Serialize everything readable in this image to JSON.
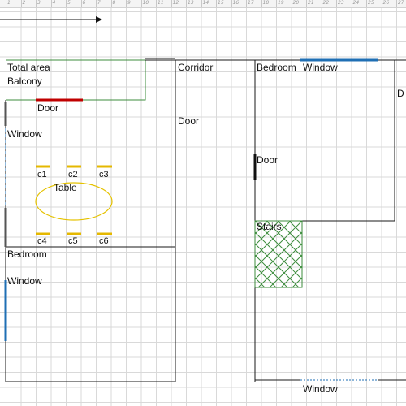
{
  "ruler": {
    "ticks": [
      "1",
      "2",
      "3",
      "4",
      "5",
      "6",
      "7",
      "8",
      "9",
      "10",
      "11",
      "12",
      "13",
      "14",
      "15",
      "16",
      "17",
      "18",
      "19",
      "20",
      "21",
      "22",
      "23",
      "24",
      "25",
      "26",
      "27",
      "28"
    ]
  },
  "labels": {
    "total_area": "Total area",
    "balcony": "Balcony",
    "door_balcony": "Door",
    "window_left": "Window",
    "corridor": "Corridor",
    "door_corridor": "Door",
    "bedroom_top": "Bedroom",
    "window_top": "Window",
    "door_right": "Door",
    "door_edge": "D",
    "table": "Table",
    "c1": "c1",
    "c2": "c2",
    "c3": "c3",
    "c4": "c4",
    "c5": "c5",
    "c6": "c6",
    "bedroom_bottom": "Bedroom",
    "window_left_bottom": "Window",
    "stairs": "Stairs",
    "window_bottom": "Window"
  },
  "colors": {
    "walls": "#1a1a1a",
    "balcony_outline": "#3c8c3c",
    "balcony_door": "#c00000",
    "window": "#1f6fb4",
    "chair": "#e5b800",
    "table": "#e5c200",
    "stairs": "#3c8c3c",
    "grid": "#d9d9d9"
  }
}
